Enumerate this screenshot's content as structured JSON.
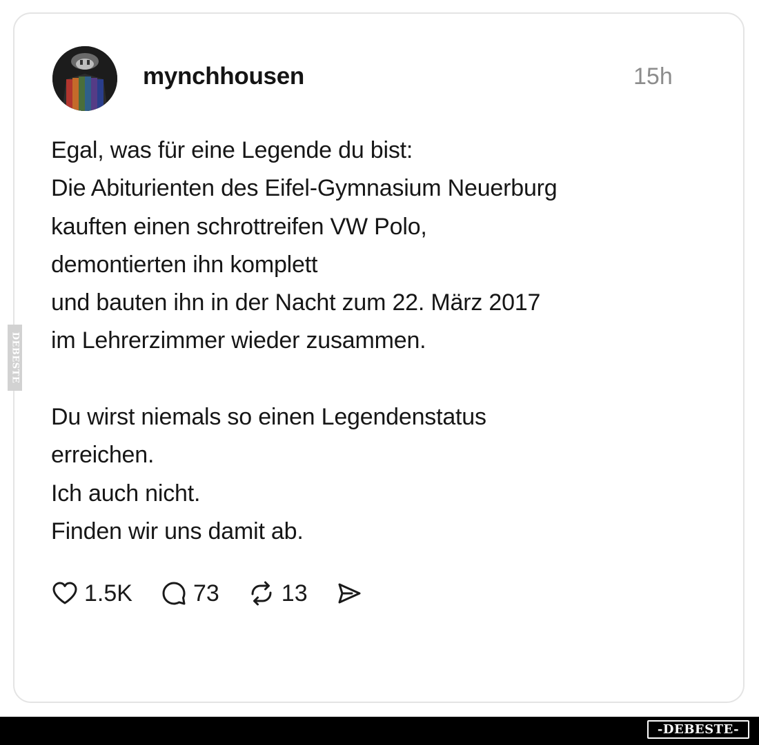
{
  "post": {
    "username": "mynchhousen",
    "timestamp": "15h",
    "avatar_icon": "profile-avatar-icon",
    "text_lines": [
      "Egal, was für eine Legende du bist:",
      "Die Abiturienten des Eifel-Gymnasium Neuerburg",
      "kauften einen schrottreifen VW Polo,",
      "demontierten ihn komplett",
      "und bauten ihn in der Nacht zum 22. März 2017",
      "im Lehrerzimmer wieder zusammen.",
      "",
      "Du wirst niemals so einen Legendenstatus",
      "erreichen.",
      "Ich auch nicht.",
      "Finden wir uns damit ab."
    ]
  },
  "actions": {
    "like": {
      "icon": "heart-icon",
      "count": "1.5K"
    },
    "comment": {
      "icon": "comment-bubble-icon",
      "count": "73"
    },
    "repost": {
      "icon": "repost-icon",
      "count": "13"
    },
    "share": {
      "icon": "send-icon"
    }
  },
  "watermark": {
    "side_text": "DEBESTE",
    "logo_text": "-DEBESTE-"
  },
  "colors": {
    "background": "#ffffff",
    "card_border": "#e4e4e4",
    "text": "#161616",
    "muted": "#8c8c8c",
    "watermark_bar": "#000000"
  }
}
